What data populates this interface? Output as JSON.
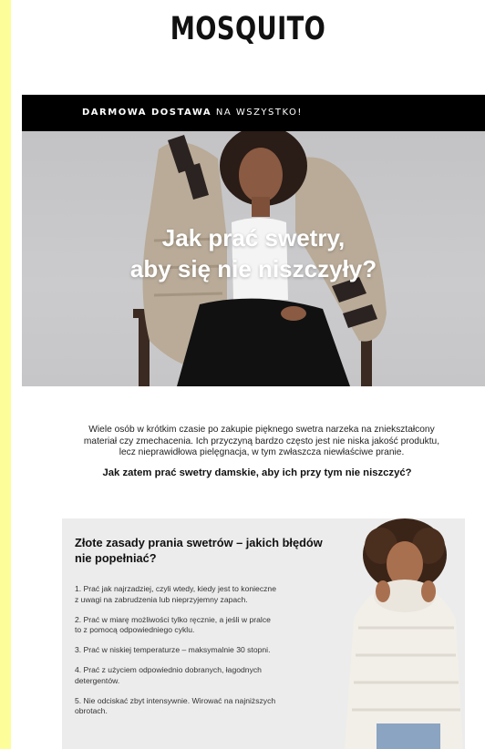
{
  "brand": {
    "logo": "MOSQUITO"
  },
  "banner": {
    "bold_text": "DARMOWA DOSTAWA",
    "rest_text": " NA WSZYSTKO!"
  },
  "hero": {
    "title_line1": "Jak prać swetry,",
    "title_line2": "aby się nie niszczyły?"
  },
  "intro": {
    "line1": "Wiele osób w krótkim czasie po zakupie pięknego swetra narzeka na zniekształcony",
    "line2": "materiał czy zmechacenia. Ich przyczyną bardzo często jest nie niska jakość produktu,",
    "line3": "lecz nieprawidłowa pielęgnacja, w tym zwłaszcza niewłaściwe pranie.",
    "question": "Jak zatem prać swetry damskie, aby ich przy tym nie niszczyć?"
  },
  "rules": {
    "title_line1": "Złote zasady prania swetrów – jakich błędów",
    "title_line2": "nie popełniać?",
    "items": [
      {
        "line1": "1. Prać jak najrzadziej, czyli wtedy, kiedy jest to konieczne",
        "line2": "z uwagi na zabrudzenia lub nieprzyjemny zapach."
      },
      {
        "line1": "2. Prać w miarę możliwości tylko ręcznie, a jeśli w pralce",
        "line2": "to z pomocą odpowiedniego cyklu."
      },
      {
        "line1": "3. Prać w niskiej temperaturze – maksymalnie 30 stopni.",
        "line2": ""
      },
      {
        "line1": "4. Prać z użyciem odpowiednio dobranych, łagodnych",
        "line2": "detergentów."
      },
      {
        "line1": "5. Nie odciskać zbyt intensywnie. Wirować na najniższych",
        "line2": "obrotach."
      }
    ]
  }
}
